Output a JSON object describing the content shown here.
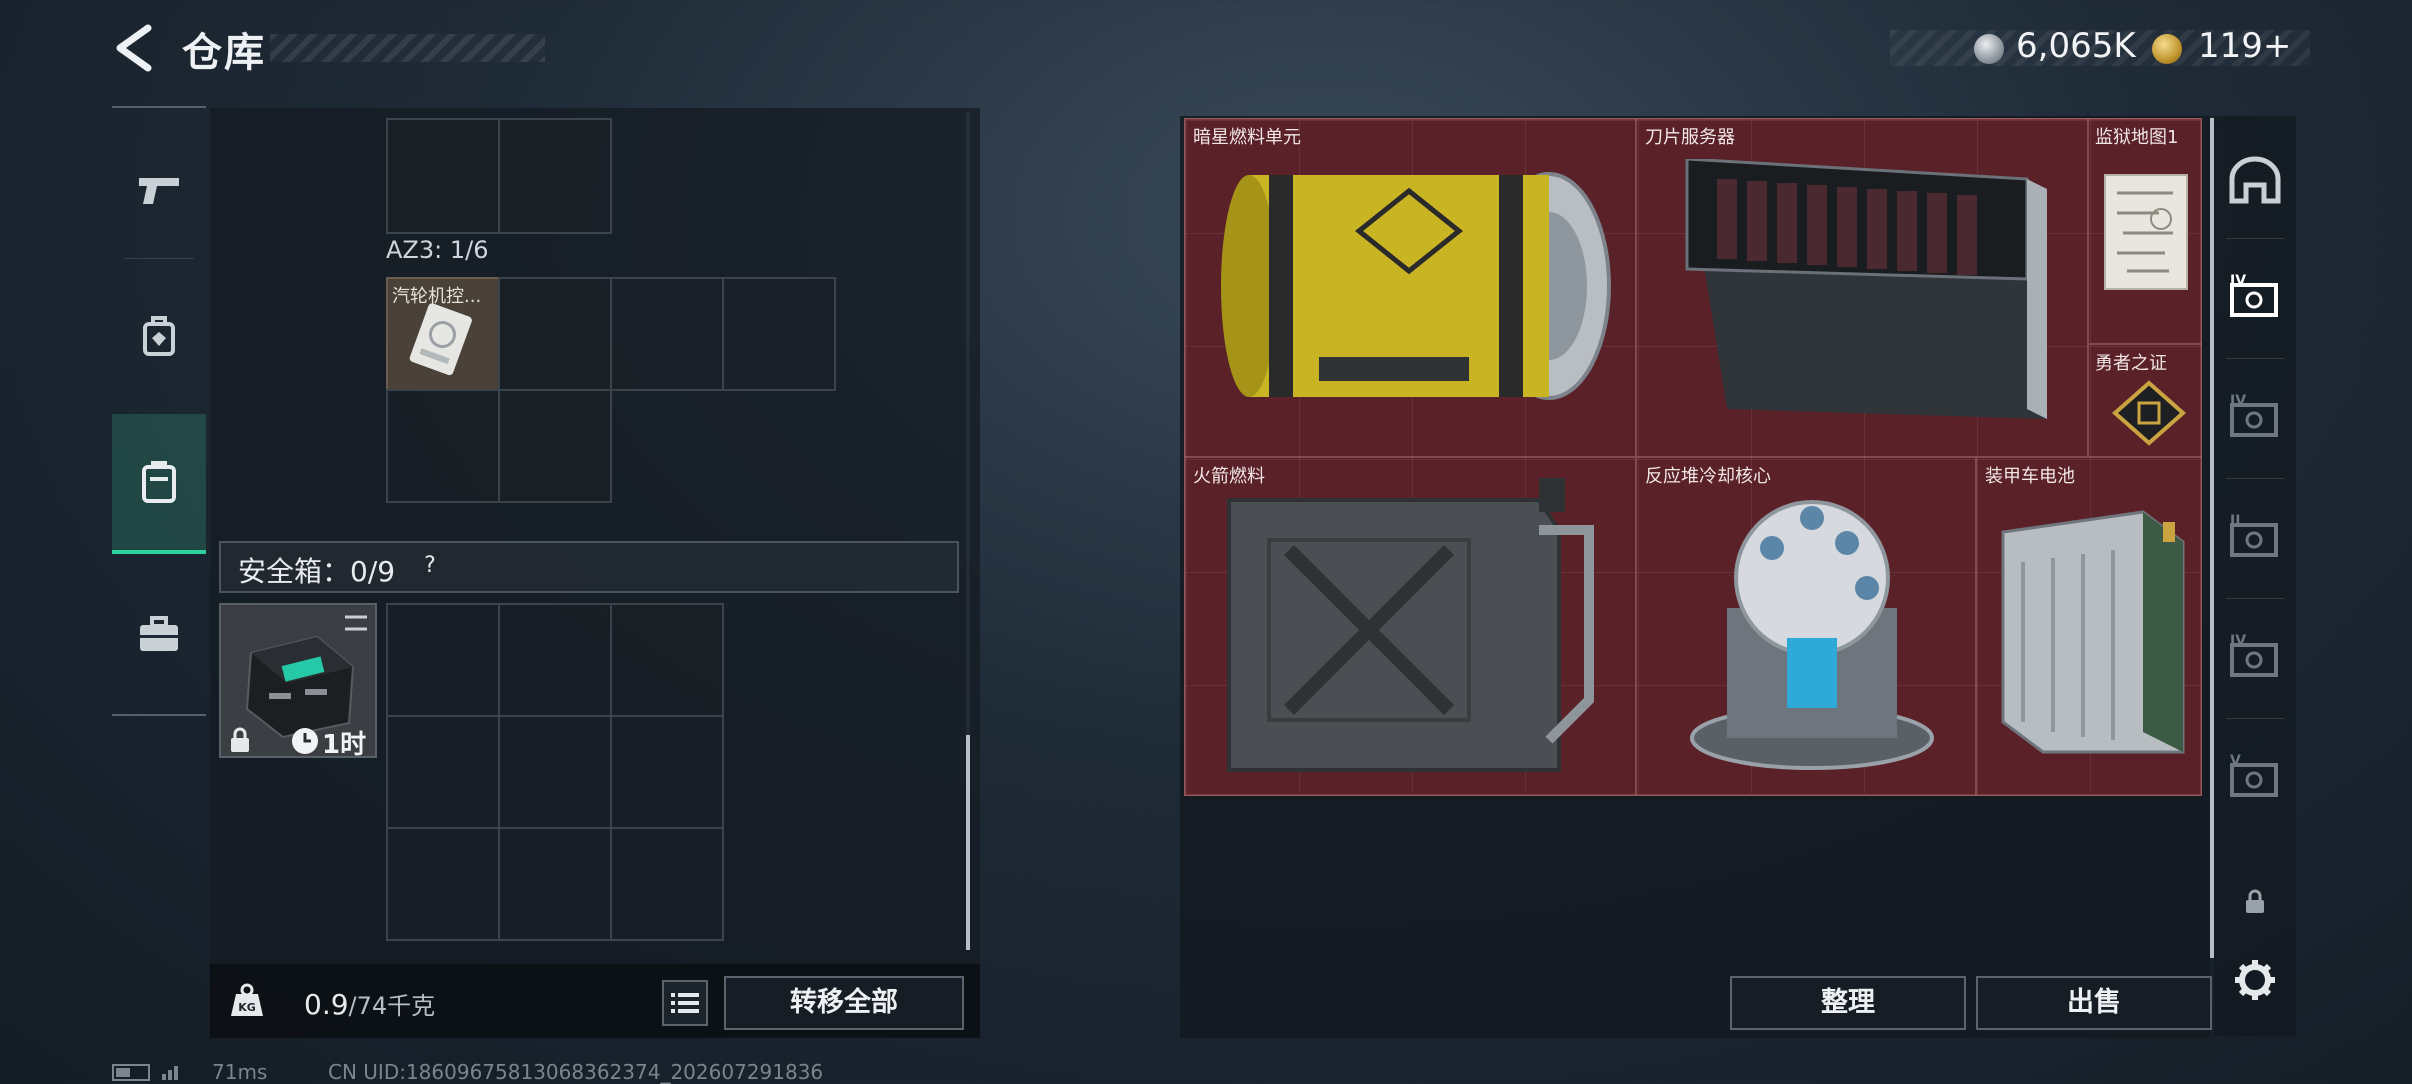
{
  "header": {
    "title": "仓库",
    "currency_silver": "6,065K",
    "currency_gold": "119+"
  },
  "left_rail": [
    "pistol-icon",
    "backpack-icon",
    "container-icon",
    "briefcase-icon"
  ],
  "grid": {
    "az3_label": "AZ3: 1/6",
    "turbine_item": "汽轮机控..."
  },
  "safe": {
    "label": "安全箱：0/9",
    "help": "?",
    "time": "1时"
  },
  "footer_left": {
    "weight_value": "0.9",
    "weight_max": "/74千克",
    "transfer_all": "转移全部"
  },
  "stash_items": [
    {
      "name": "暗星燃料单元"
    },
    {
      "name": "刀片服务器"
    },
    {
      "name": "监狱地图1"
    },
    {
      "name": "勇者之证"
    },
    {
      "name": "火箭燃料"
    },
    {
      "name": "反应堆冷却核心"
    },
    {
      "name": "装甲车电池"
    }
  ],
  "right_buttons": {
    "sort": "整理",
    "sell": "出售"
  },
  "right_rail": [
    "map-icon",
    "safe-iv-icon",
    "safe-iv-icon",
    "safe-ii-icon",
    "safe-iv-icon",
    "safe-v-icon",
    "lock-icon",
    "settings-icon"
  ],
  "status": {
    "ping": "71ms",
    "uid": "CN UID:1860967581306836237​4_202607291836"
  }
}
